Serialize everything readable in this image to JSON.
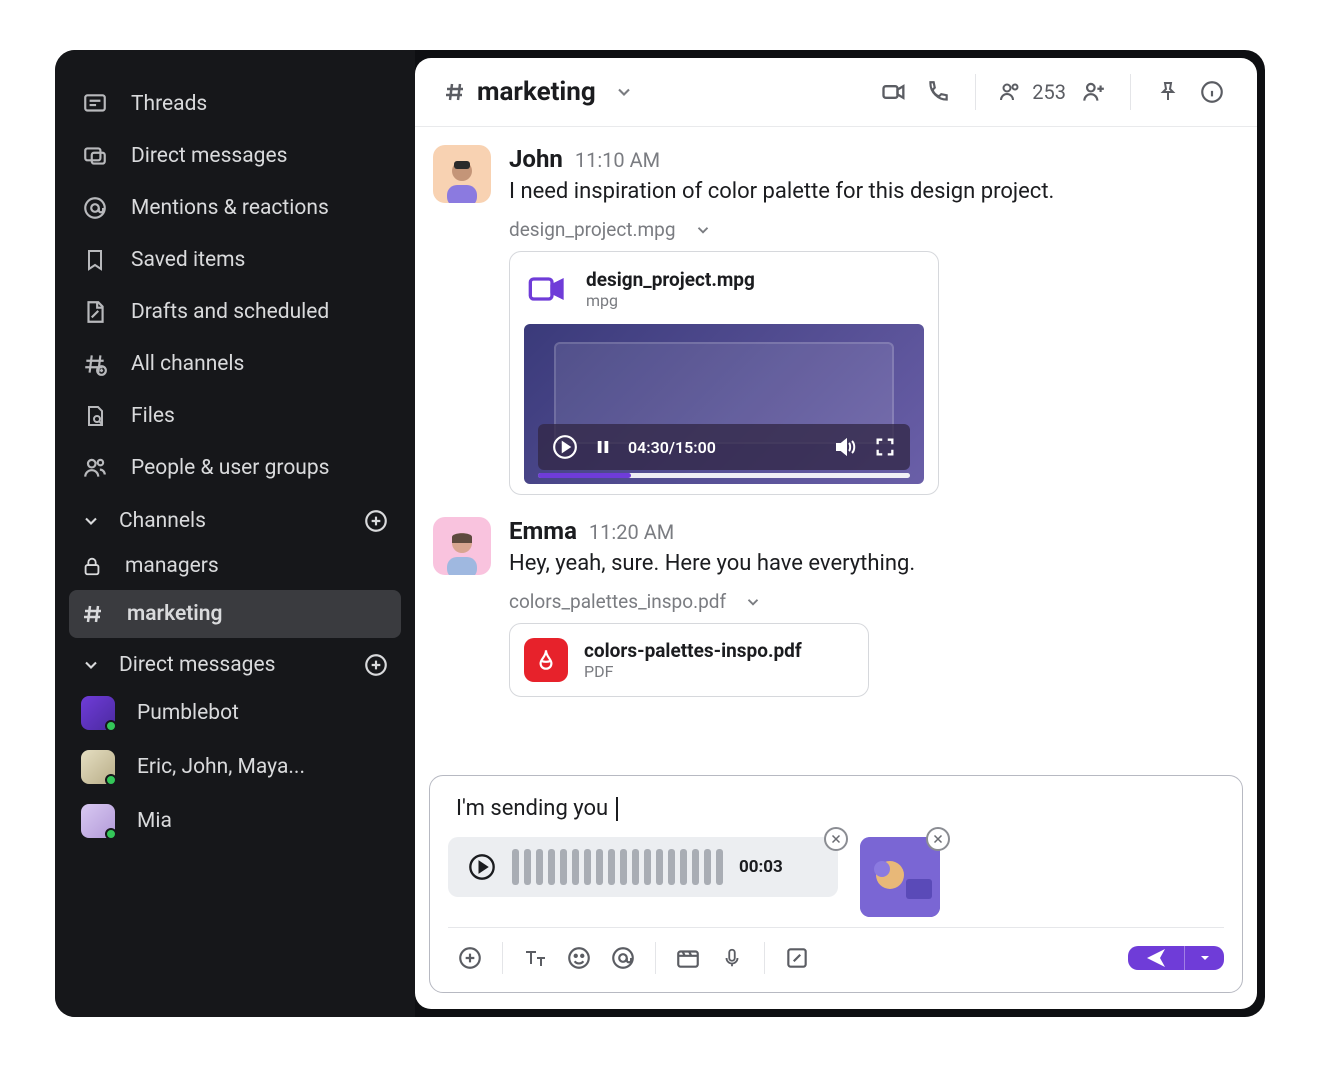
{
  "sidebar": {
    "nav": [
      {
        "icon": "threads",
        "label": "Threads"
      },
      {
        "icon": "dm",
        "label": "Direct messages"
      },
      {
        "icon": "mentions",
        "label": "Mentions & reactions"
      },
      {
        "icon": "saved",
        "label": "Saved items"
      },
      {
        "icon": "drafts",
        "label": "Drafts and scheduled"
      },
      {
        "icon": "allchan",
        "label": "All channels"
      },
      {
        "icon": "files",
        "label": "Files"
      },
      {
        "icon": "people",
        "label": "People & user groups"
      }
    ],
    "channels_header": "Channels",
    "channels": [
      {
        "icon": "lock",
        "label": "managers",
        "active": false
      },
      {
        "icon": "hash",
        "label": "marketing",
        "active": true
      }
    ],
    "dm_header": "Direct messages",
    "dms": [
      {
        "label": "Pumblebot",
        "color": "#6f3cd8"
      },
      {
        "label": "Eric, John, Maya...",
        "color": "#c9c0a2"
      },
      {
        "label": "Mia",
        "color": "#c9b7e6"
      }
    ]
  },
  "header": {
    "channel_name": "marketing",
    "member_count": "253"
  },
  "messages": [
    {
      "author": "John",
      "time": "11:10 AM",
      "avatar": "#f8c9a4",
      "text": "I need inspiration of color palette for this design project.",
      "attachment_label": "design_project.mpg",
      "video": {
        "filename": "design_project.mpg",
        "filetype": "mpg",
        "time": "04:30/15:00"
      }
    },
    {
      "author": "Emma",
      "time": "11:20 AM",
      "avatar": "#f7b9d5",
      "text": "Hey, yeah, sure. Here you have everything.",
      "attachment_label": "colors_palettes_inspo.pdf",
      "pdf": {
        "filename": "colors-palettes-inspo.pdf",
        "filetype": "PDF"
      }
    }
  ],
  "composer": {
    "input": "I'm sending you ",
    "audio_duration": "00:03"
  }
}
